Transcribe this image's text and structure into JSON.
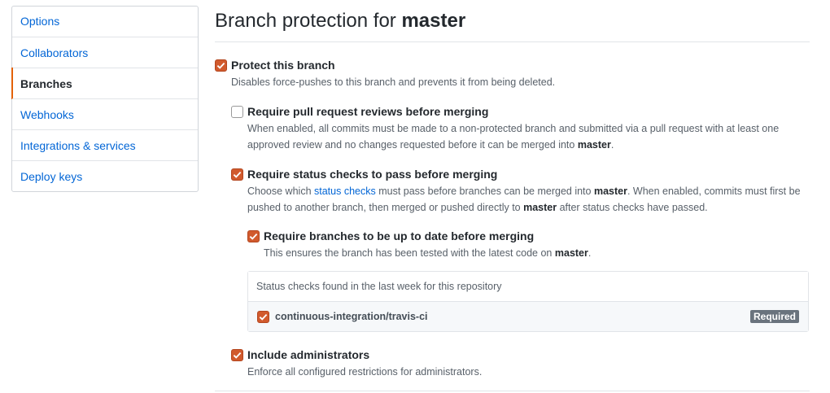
{
  "sidebar": {
    "items": [
      {
        "label": "Options"
      },
      {
        "label": "Collaborators"
      },
      {
        "label": "Branches"
      },
      {
        "label": "Webhooks"
      },
      {
        "label": "Integrations & services"
      },
      {
        "label": "Deploy keys"
      }
    ],
    "selected": "Branches"
  },
  "page": {
    "title_prefix": "Branch protection for ",
    "branch": "master"
  },
  "options": {
    "protect": {
      "checked": true,
      "label": "Protect this branch",
      "desc": "Disables force-pushes to this branch and prevents it from being deleted."
    },
    "reviews": {
      "checked": false,
      "label": "Require pull request reviews before merging",
      "desc_1": "When enabled, all commits must be made to a non-protected branch and submitted via a pull request with at least one approved review and no changes requested before it can be merged into ",
      "desc_branch": "master",
      "desc_2": "."
    },
    "status": {
      "checked": true,
      "label": "Require status checks to pass before merging",
      "desc_1": "Choose which ",
      "desc_link": "status checks",
      "desc_2": " must pass before branches can be merged into ",
      "desc_branch": "master",
      "desc_3": ". When enabled, commits must first be pushed to another branch, then merged or pushed directly to ",
      "desc_branch2": "master",
      "desc_4": " after status checks have passed."
    },
    "uptodate": {
      "checked": true,
      "label": "Require branches to be up to date before merging",
      "desc_1": "This ensures the branch has been tested with the latest code on ",
      "desc_branch": "master",
      "desc_2": "."
    },
    "admins": {
      "checked": true,
      "label": "Include administrators",
      "desc": "Enforce all configured restrictions for administrators."
    }
  },
  "status_checks": {
    "header": "Status checks found in the last week for this repository",
    "items": [
      {
        "name": "continuous-integration/travis-ci",
        "checked": true,
        "badge": "Required"
      }
    ]
  },
  "colors": {
    "accent": "#d15a2d",
    "link": "#0366d6",
    "selected_bar": "#e36209"
  }
}
